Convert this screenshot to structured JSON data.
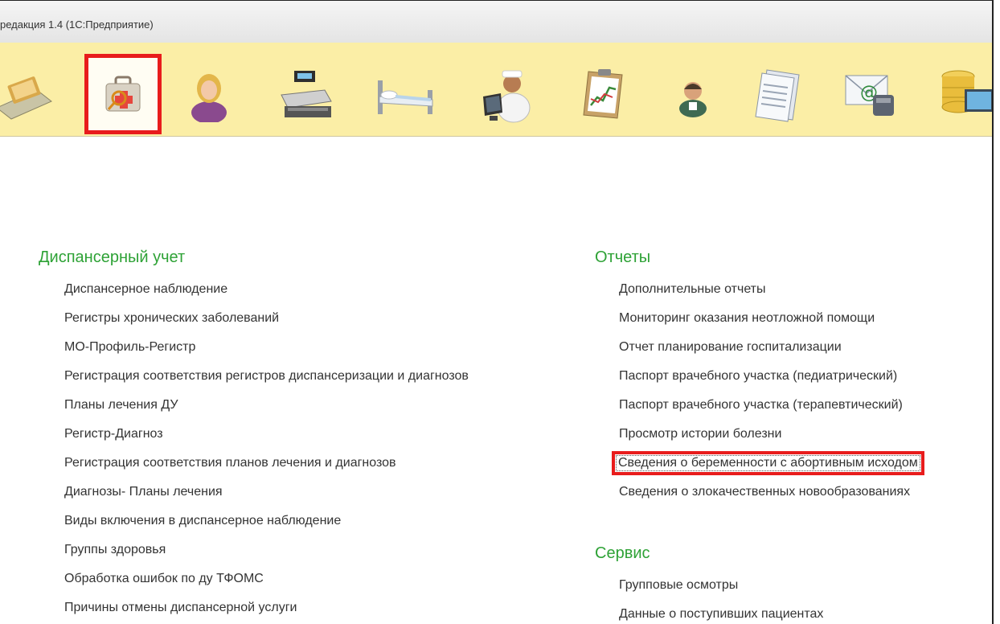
{
  "window": {
    "title": "редакция 1.4  (1С:Предприятие)"
  },
  "toolbar": {
    "sections": [
      {
        "icon": "workplace-icon",
        "active": false
      },
      {
        "icon": "medical-kit-icon",
        "active": true
      },
      {
        "icon": "patient-woman-icon",
        "active": false
      },
      {
        "icon": "cash-register-icon",
        "active": false
      },
      {
        "icon": "hospital-bed-icon",
        "active": false
      },
      {
        "icon": "nurse-workstation-icon",
        "active": false
      },
      {
        "icon": "clipboard-chart-icon",
        "active": false
      },
      {
        "icon": "doctor-icon",
        "active": false
      },
      {
        "icon": "documents-icon",
        "active": false
      },
      {
        "icon": "email-phone-icon",
        "active": false
      },
      {
        "icon": "database-computer-icon",
        "active": false
      }
    ]
  },
  "left": {
    "title": "Диспансерный учет",
    "items": [
      "Диспансерное наблюдение",
      "Регистры хронических заболеваний",
      "МО-Профиль-Регистр",
      "Регистрация соответствия регистров диспансеризации и диагнозов",
      "Планы лечения ДУ",
      "Регистр-Диагноз",
      "Регистрация соответствия планов лечения и диагнозов",
      "Диагнозы- Планы лечения",
      "Виды включения в диспансерное наблюдение",
      "Группы здоровья",
      "Обработка ошибок по ду ТФОМС",
      "Причины отмены диспансерной услуги"
    ]
  },
  "reports": {
    "title": "Отчеты",
    "items": [
      "Дополнительные отчеты",
      "Мониторинг оказания неотложной помощи",
      "Отчет планирование госпитализации",
      "Паспорт врачебного участка (педиатрический)",
      "Паспорт врачебного участка (терапевтический)",
      "Просмотр истории болезни",
      "Сведения о беременности с абортивным исходом",
      "Сведения о злокачественных новообразованиях"
    ]
  },
  "service": {
    "title": "Сервис",
    "items": [
      "Групповые осмотры",
      "Данные о поступивших пациентах"
    ]
  },
  "colors": {
    "toolbar_bg": "#fbeea6",
    "section_title": "#2ea236",
    "highlight": "#e81c1c"
  }
}
